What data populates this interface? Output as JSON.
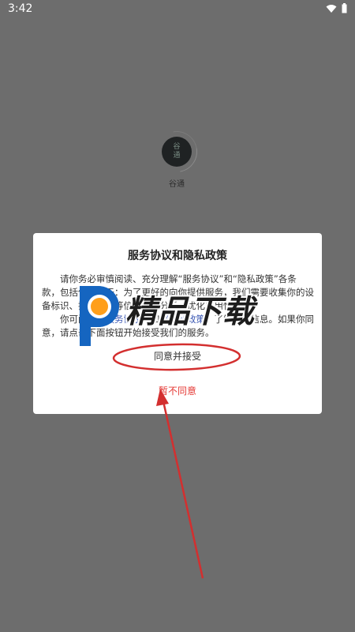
{
  "status_bar": {
    "time": "3:42"
  },
  "background_app": {
    "logo_text_line1": "谷",
    "logo_text_line2": "通",
    "app_name": "谷通"
  },
  "dialog": {
    "title": "服务协议和隐私政策",
    "para1": "请你务必审慎阅读、充分理解“服务协议”和“隐私政策”各条款，包括但不限于：为了更好的向你提供服务，我们需要收集你的设备标识、操作日志等信息用于分析、优化应用性能。",
    "para2_prefix": "你可阅读",
    "para2_link1": "《服务协议》",
    "para2_and": "和",
    "para2_link2": "《隐私政策》",
    "para2_suffix": "了解详细信息。如果你同意，请点击下面按钮开始接受我们的服务。",
    "accept_label": "同意并接受",
    "reject_label": "暂不同意"
  },
  "watermark": {
    "text": "精品下载"
  },
  "colors": {
    "overlay": "#6d6d6d",
    "reject": "#e53935",
    "annotation": "#d32f2f",
    "link": "#3a57b3"
  }
}
